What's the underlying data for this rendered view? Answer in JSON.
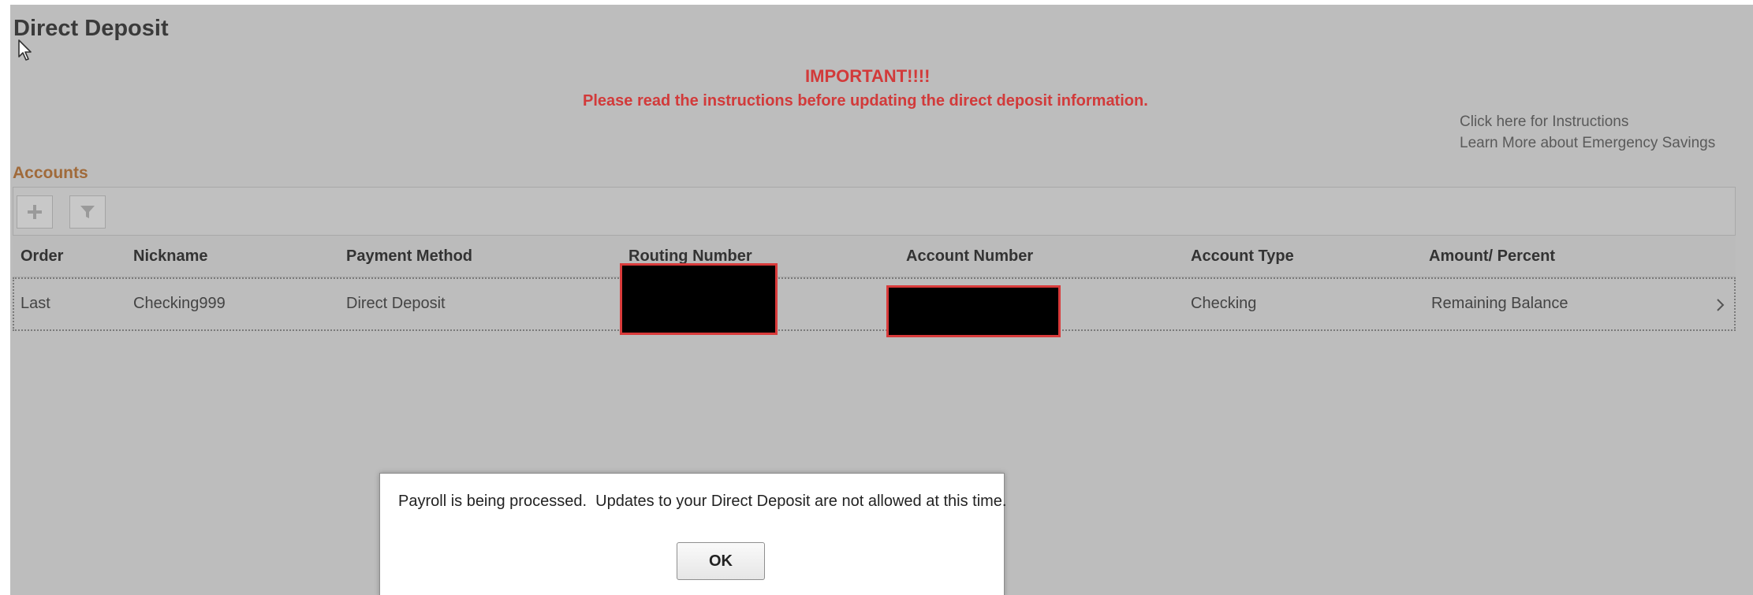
{
  "page": {
    "title": "Direct Deposit"
  },
  "notice": {
    "heading": "IMPORTANT!!!!",
    "subheading": "Please read the instructions before updating the direct deposit information."
  },
  "links": {
    "instructions": "Click here for Instructions",
    "emergency_savings": "Learn More about Emergency Savings"
  },
  "accounts": {
    "section_title": "Accounts",
    "toolbar": {
      "add_icon": "plus-icon",
      "filter_icon": "filter-icon"
    },
    "columns": {
      "order": "Order",
      "nickname": "Nickname",
      "payment_method": "Payment Method",
      "routing_number": "Routing Number",
      "account_number": "Account Number",
      "account_type": "Account Type",
      "amount_percent": "Amount/ Percent"
    },
    "rows": [
      {
        "order": "Last",
        "nickname": "Checking999",
        "payment_method": "Direct Deposit",
        "account_type": "Checking",
        "amount_percent": "Remaining Balance"
      }
    ]
  },
  "dialog": {
    "message": "Payroll is being processed.  Updates to your Direct Deposit are not allowed at this time.",
    "ok_label": "OK"
  },
  "colors": {
    "background": "#bdbdbd",
    "alert_red": "#d23a3a",
    "section_brown": "#a06a3a",
    "redaction_border": "#d93b3b"
  }
}
